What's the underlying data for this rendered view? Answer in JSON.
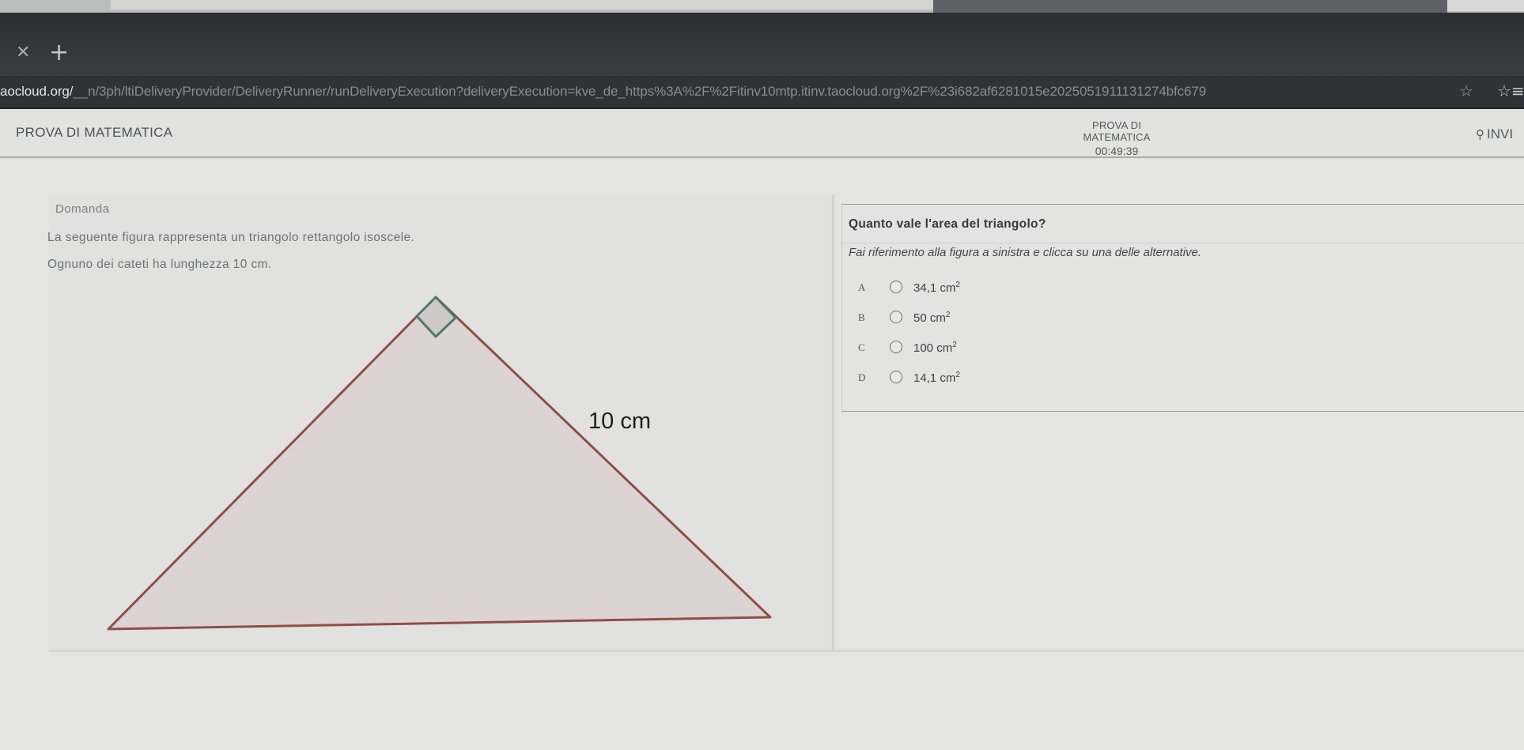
{
  "browser": {
    "tab_close_icon": "close-icon",
    "tab_new_icon": "plus-icon",
    "url_host": "aocloud.org/",
    "url_rest": "__n/3ph/ltiDeliveryProvider/DeliveryRunner/runDeliveryExecution?deliveryExecution=kve_de_https%3A%2F%2Fitinv10mtp.itinv.taocloud.org%2F%23i682af6281015e2025051911131274bfc679",
    "star_icon": "star-icon",
    "favorites_icon": "favorites-icon"
  },
  "header": {
    "title": "PROVA DI MATEMATICA",
    "timer_title": "PROVA DI MATEMATICA",
    "timer_value": "00:49:39",
    "send_label": "INVI"
  },
  "left": {
    "label": "Domanda",
    "stem_line1": "La seguente figura rappresenta un triangolo rettangolo isoscele.",
    "stem_line2": "Ognuno dei cateti ha lunghezza 10 cm.",
    "figure_label": "10 cm"
  },
  "question": {
    "title": "Quanto vale l'area del triangolo?",
    "instruction": "Fai riferimento alla figura a sinistra e clicca su una delle alternative.",
    "choices": [
      {
        "letter": "A",
        "value": "34,1 cm",
        "exp": "2"
      },
      {
        "letter": "B",
        "value": "50 cm",
        "exp": "2"
      },
      {
        "letter": "C",
        "value": "100 cm",
        "exp": "2"
      },
      {
        "letter": "D",
        "value": "14,1 cm",
        "exp": "2"
      }
    ]
  },
  "colors": {
    "triangle_fill": "#dbd4d3",
    "triangle_stroke": "#8f4f45",
    "right_angle_mark": "#4d7a70"
  }
}
